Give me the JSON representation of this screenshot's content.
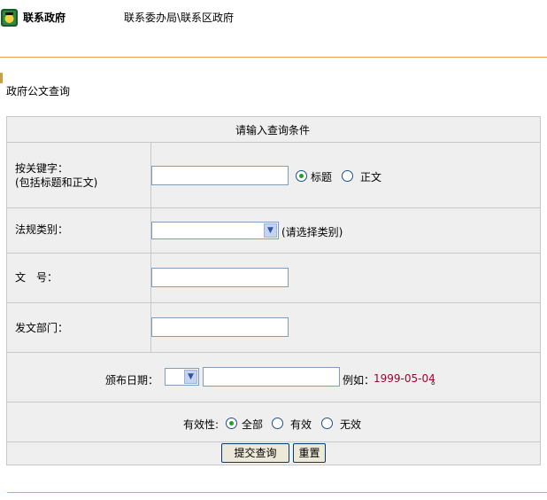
{
  "header": {
    "brand": "联系政府",
    "breadcrumb": "联系委办局\\联系区政府"
  },
  "section": {
    "title": "政府公文查询"
  },
  "form": {
    "heading": "请输入查询条件",
    "keyword_label_1": "按关键字：",
    "keyword_label_2": "(包括标题和正文)",
    "scope_title": "标题",
    "scope_body": "正文",
    "category_label": "法规类别：",
    "category_hint": "(请选择类别)",
    "doc_no_label": "文　号：",
    "dept_label": "发文部门：",
    "date_label": "颁布日期：",
    "date_example_prefix": "例如：",
    "date_example": "1999-05-04",
    "date_example_suffix": "。",
    "validity_label": "有效性:",
    "validity_all": "全部",
    "validity_valid": "有效",
    "validity_invalid": "无效",
    "submit_label": "提交查询",
    "reset_label": "重置",
    "scope_selected": "标题",
    "validity_selected": "全部"
  }
}
